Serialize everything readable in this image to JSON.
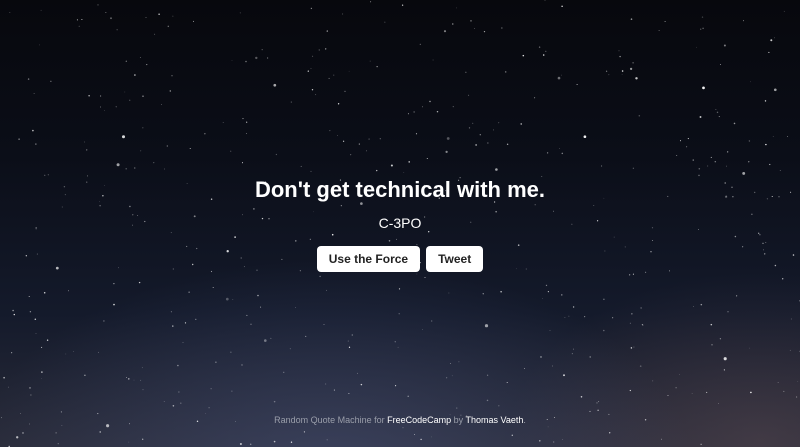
{
  "quote": {
    "text": "Don't get technical with me.",
    "author": "C-3PO"
  },
  "buttons": {
    "new_quote_label": "Use the Force",
    "tweet_label": "Tweet"
  },
  "footer": {
    "prefix": "Random Quote Machine for ",
    "link_freecodecamp": "FreeCodeCamp",
    "by_text": " by ",
    "link_author": "Thomas Vaeth",
    "suffix": "."
  },
  "colors": {
    "text": "#ffffff",
    "button_bg": "#ffffff",
    "button_text": "#222222",
    "footer_text": "#9a9eaa"
  }
}
